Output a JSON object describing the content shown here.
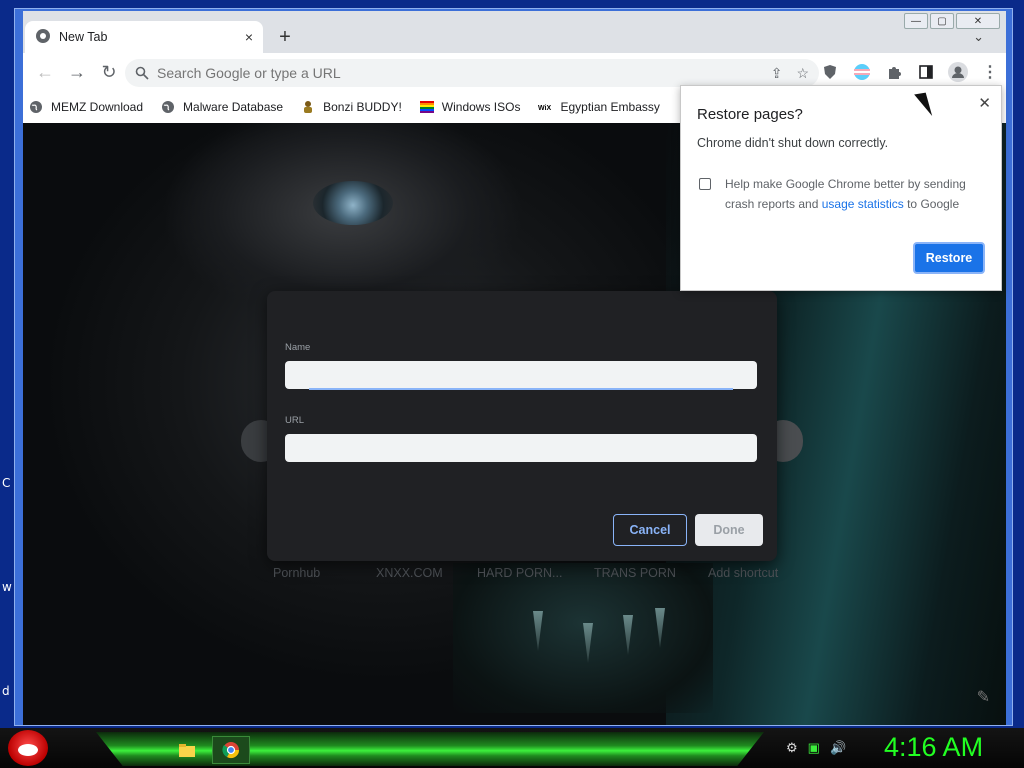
{
  "window": {
    "min": "—",
    "max": "▢",
    "close": "✕"
  },
  "tab": {
    "title": "New Tab",
    "close": "×",
    "new_tab": "+",
    "search_tabs": "⌄"
  },
  "toolbar": {
    "back": "←",
    "forward": "→",
    "reload": "↻",
    "omnibox_placeholder": "Search Google or type a URL",
    "share": "⇪",
    "star": "☆",
    "menu": "⋮"
  },
  "bookmarks": [
    {
      "label": "MEMZ Download",
      "icon": "globe-icon"
    },
    {
      "label": "Malware Database",
      "icon": "globe-icon"
    },
    {
      "label": "Bonzi BUDDY!",
      "icon": "bonzi-icon"
    },
    {
      "label": "Windows ISOs",
      "icon": "rainbow-flag-icon"
    },
    {
      "label": "Egyptian Embassy",
      "icon": "wix-icon"
    }
  ],
  "shortcuts": [
    "Pornhub",
    "XNXX.COM",
    "HARD PORN...",
    "TRANS PORN",
    "Add shortcut"
  ],
  "dialog": {
    "name_label": "Name",
    "url_label": "URL",
    "name_value": "",
    "url_value": "",
    "cancel": "Cancel",
    "done": "Done"
  },
  "restore_popup": {
    "title": "Restore pages?",
    "message": "Chrome didn't shut down correctly.",
    "checkbox_before": "Help make Google Chrome better by sending crash reports and ",
    "checkbox_link": "usage statistics",
    "checkbox_after": " to Google",
    "button": "Restore",
    "close": "✕"
  },
  "desktop_letters": [
    "C",
    "w",
    "d"
  ],
  "taskbar": {
    "clock": "4:16 AM"
  },
  "colors": {
    "accent": "#1a73e8",
    "dialog_bg": "#202124",
    "clock": "#22ff22"
  }
}
